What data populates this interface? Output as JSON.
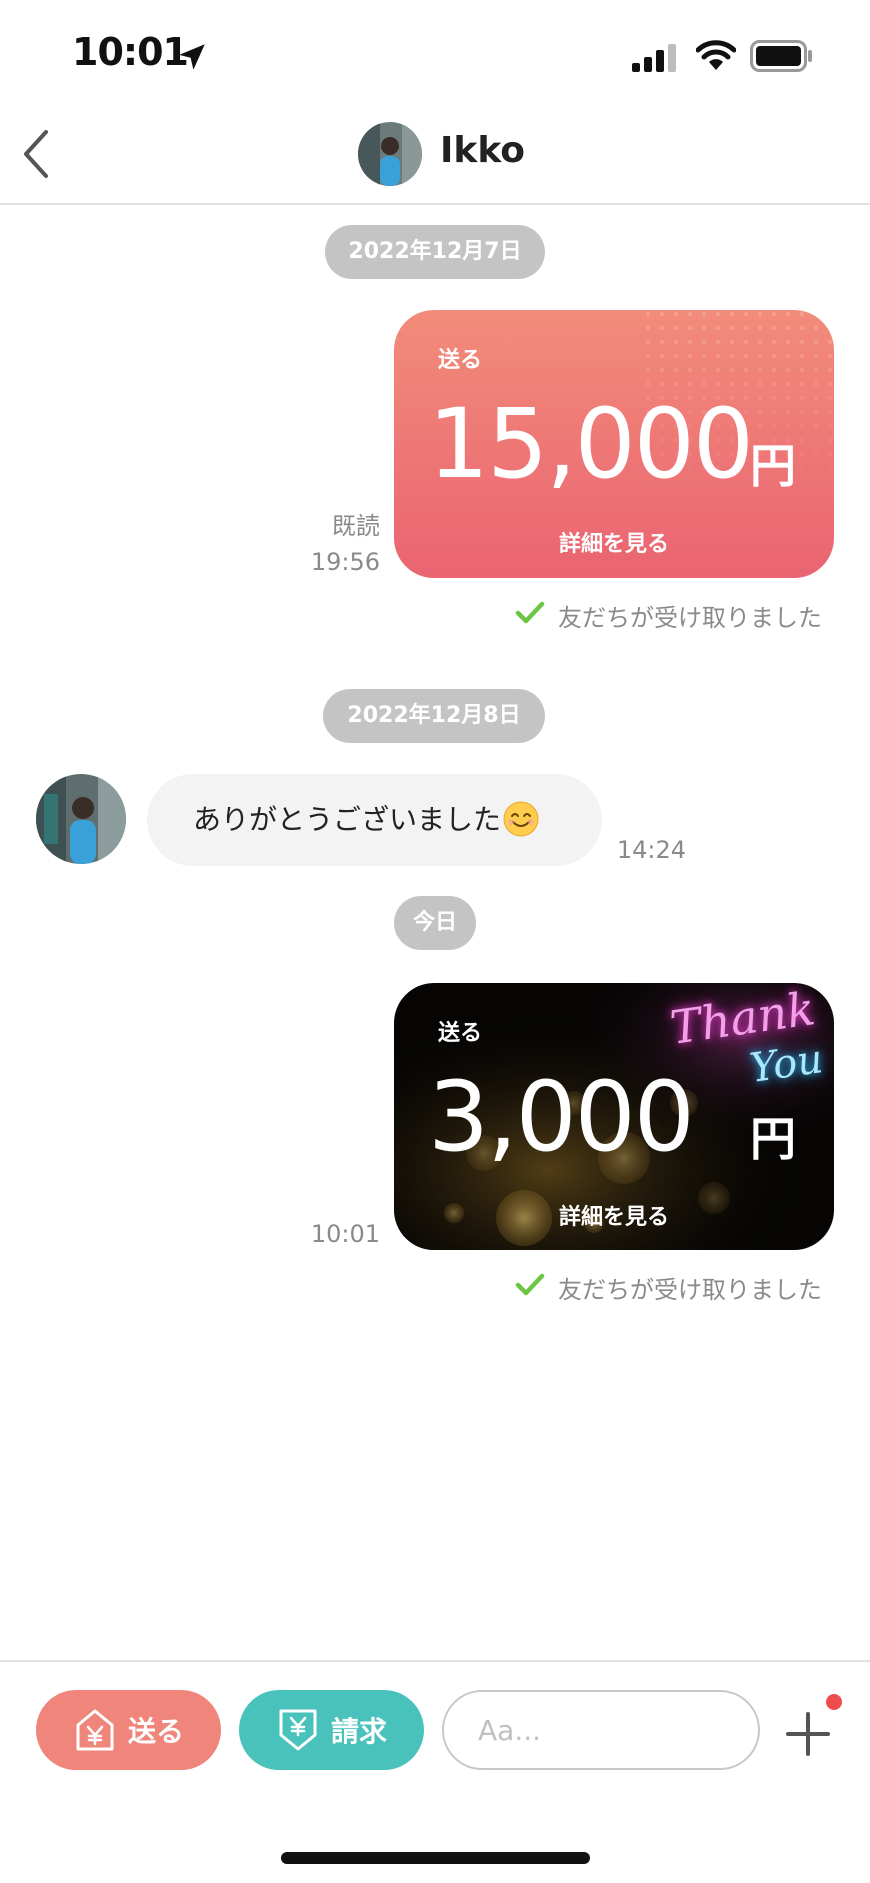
{
  "status_bar": {
    "time": "10:01"
  },
  "header": {
    "contact_name": "Ikko"
  },
  "chat": {
    "date_1": "2022年12月7日",
    "card_1": {
      "label": "送る",
      "amount": "15,000",
      "currency": "円",
      "detail_link": "詳細を見る",
      "read_status": "既読",
      "time": "19:56",
      "receipt": "友だちが受け取りました"
    },
    "date_2": "2022年12月8日",
    "message_1": {
      "text": "ありがとうございました",
      "time": "14:24"
    },
    "date_3": "今日",
    "card_2": {
      "label": "送る",
      "amount": "3,000",
      "currency": "円",
      "detail_link": "詳細を見る",
      "time": "10:01",
      "receipt": "友だちが受け取りました",
      "neon_text_1": "Thank",
      "neon_text_2": "You"
    }
  },
  "bottom_bar": {
    "send_label": "送る",
    "request_label": "請求",
    "input_placeholder": "Aa..."
  },
  "colors": {
    "send_button": "#f0857b",
    "request_button": "#48c2bb",
    "check": "#6cc644",
    "notification_dot": "#ef4d4d"
  }
}
